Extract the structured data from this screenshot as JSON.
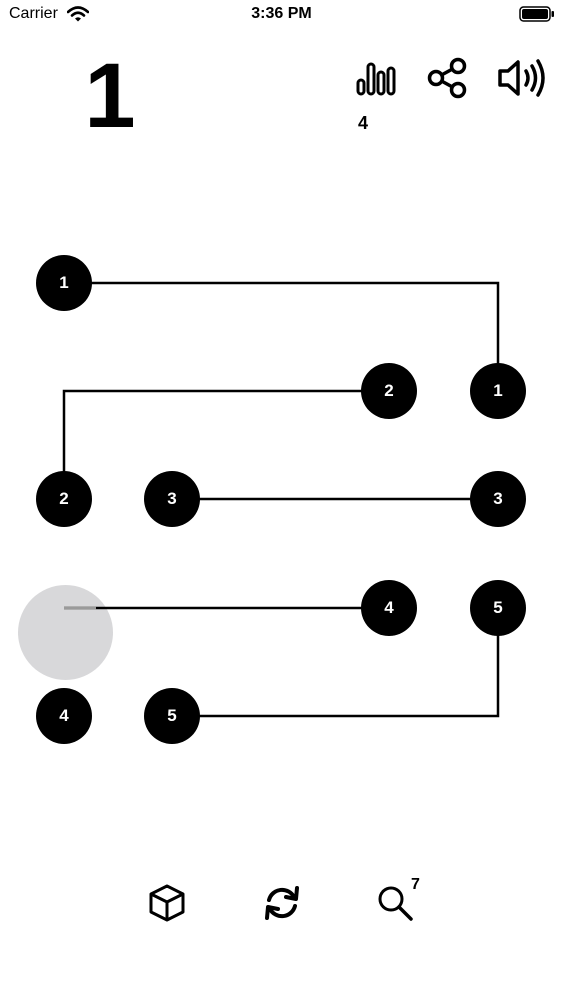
{
  "status_bar": {
    "carrier": "Carrier",
    "time": "3:36 PM"
  },
  "header": {
    "level": "1",
    "stats_count": "4"
  },
  "icons": {
    "stats": "bar-chart-icon",
    "share": "share-icon",
    "sound": "speaker-icon",
    "cube": "cube-icon",
    "restart": "refresh-icon",
    "hint": "magnifier-icon"
  },
  "hint": {
    "count": "7"
  },
  "board": {
    "nodes": [
      {
        "id": "a1",
        "label": "1"
      },
      {
        "id": "b1",
        "label": "1"
      },
      {
        "id": "a2",
        "label": "2"
      },
      {
        "id": "b2",
        "label": "2"
      },
      {
        "id": "a3",
        "label": "3"
      },
      {
        "id": "b3",
        "label": "3"
      },
      {
        "id": "a4",
        "label": "4"
      },
      {
        "id": "b4",
        "label": "4"
      },
      {
        "id": "a5",
        "label": "5"
      },
      {
        "id": "b5",
        "label": "5"
      }
    ]
  },
  "colors": {
    "node": "#000000",
    "node_text": "#ffffff",
    "touch": "#d8d8da",
    "active_line": "#9a9a9a"
  }
}
